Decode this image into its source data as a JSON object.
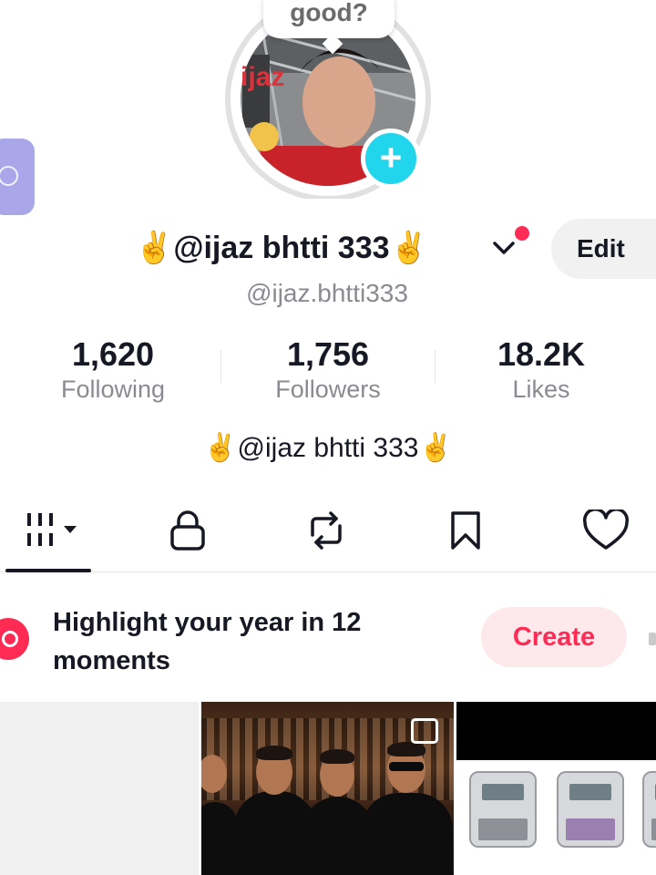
{
  "avatar": {
    "bubble_text": "good?",
    "photo_watermark": "ijaz",
    "add_button_symbol": "+"
  },
  "profile": {
    "display_name": "✌️@ijaz bhtti 333✌️",
    "username": "@ijaz.bhtti333",
    "edit_label": "Edit",
    "bio": "✌️@ijaz bhtti 333✌️"
  },
  "stats": [
    {
      "value": "1,620",
      "label": "Following"
    },
    {
      "value": "1,756",
      "label": "Followers"
    },
    {
      "value": "18.2K",
      "label": "Likes"
    }
  ],
  "tabs": [
    {
      "icon": "grid-icon",
      "active": true
    },
    {
      "icon": "lock-icon",
      "active": false
    },
    {
      "icon": "repost-icon",
      "active": false
    },
    {
      "icon": "bookmark-icon",
      "active": false
    },
    {
      "icon": "heart-icon",
      "active": false
    }
  ],
  "highlight": {
    "text": "Highlight your year in 12 moments",
    "create_label": "Create"
  },
  "colors": {
    "accent": "#fe2c55",
    "add_button": "#20d5ec",
    "text_primary": "#161823",
    "text_secondary": "#8a8b91"
  }
}
